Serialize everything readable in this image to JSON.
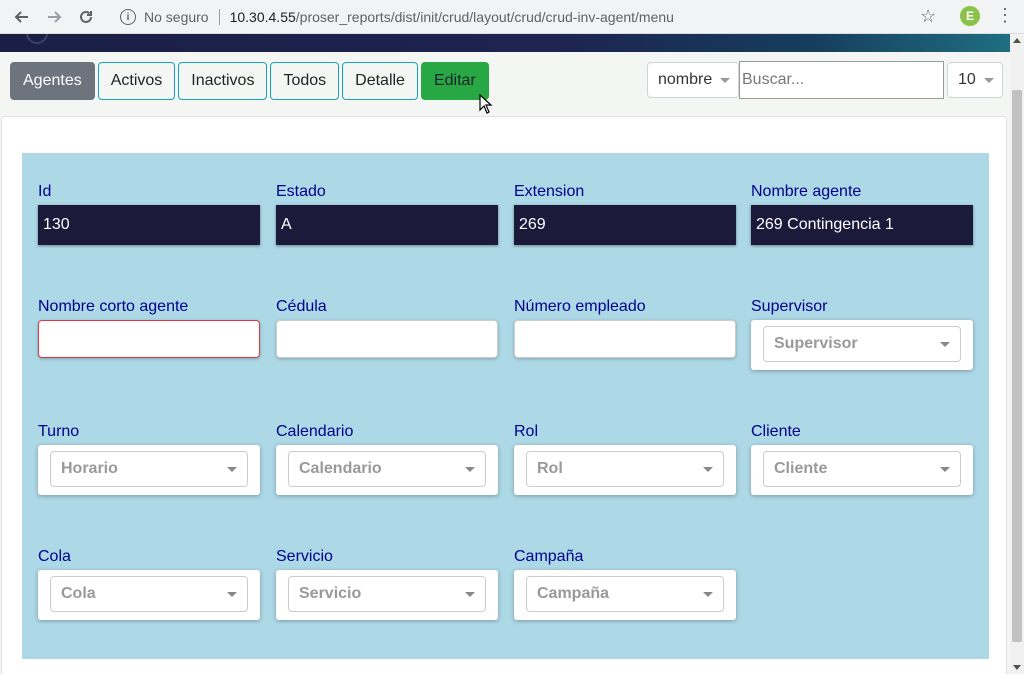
{
  "browser": {
    "security_label": "No seguro",
    "url_host": "10.30.4.55",
    "url_path": "/proser_reports/dist/init/crud/layout/crud/crud-inv-agent/menu",
    "profile_initial": "E",
    "icons": [
      "back-icon",
      "forward-icon",
      "reload-icon",
      "info-icon",
      "star-icon",
      "kebab-menu-icon"
    ]
  },
  "toolbar": {
    "tabs": [
      {
        "label": "Agentes",
        "state": "active"
      },
      {
        "label": "Activos",
        "state": "default"
      },
      {
        "label": "Inactivos",
        "state": "default"
      },
      {
        "label": "Todos",
        "state": "default"
      },
      {
        "label": "Detalle",
        "state": "default"
      },
      {
        "label": "Editar",
        "state": "edit"
      }
    ],
    "search_field_select": "nombre",
    "search_placeholder": "Buscar...",
    "page_size": "10"
  },
  "form": {
    "id": {
      "label": "Id",
      "value": "130"
    },
    "estado": {
      "label": "Estado",
      "value": "A"
    },
    "extension": {
      "label": "Extension",
      "value": "269"
    },
    "nombre_agente": {
      "label": "Nombre agente",
      "value": "269 Contingencia 1"
    },
    "nombre_corto": {
      "label": "Nombre corto agente",
      "value": ""
    },
    "cedula": {
      "label": "Cédula",
      "value": ""
    },
    "numero_empleado": {
      "label": "Número empleado",
      "value": ""
    },
    "supervisor": {
      "label": "Supervisor",
      "selected": "Supervisor"
    },
    "turno": {
      "label": "Turno",
      "selected": "Horario"
    },
    "calendario": {
      "label": "Calendario",
      "selected": "Calendario"
    },
    "rol": {
      "label": "Rol",
      "selected": "Rol"
    },
    "cliente": {
      "label": "Cliente",
      "selected": "Cliente"
    },
    "cola": {
      "label": "Cola",
      "selected": "Cola"
    },
    "servicio": {
      "label": "Servicio",
      "selected": "Servicio"
    },
    "campana": {
      "label": "Campaña",
      "selected": "Campaña"
    }
  },
  "colors": {
    "panel_bg": "#add8e6",
    "readonly_bg": "#1b1a3b",
    "label": "#00008b",
    "active_tab": "#6c757d",
    "edit_tab": "#28a745",
    "tab_border": "#17a2b8",
    "invalid_border": "#dc3545"
  }
}
